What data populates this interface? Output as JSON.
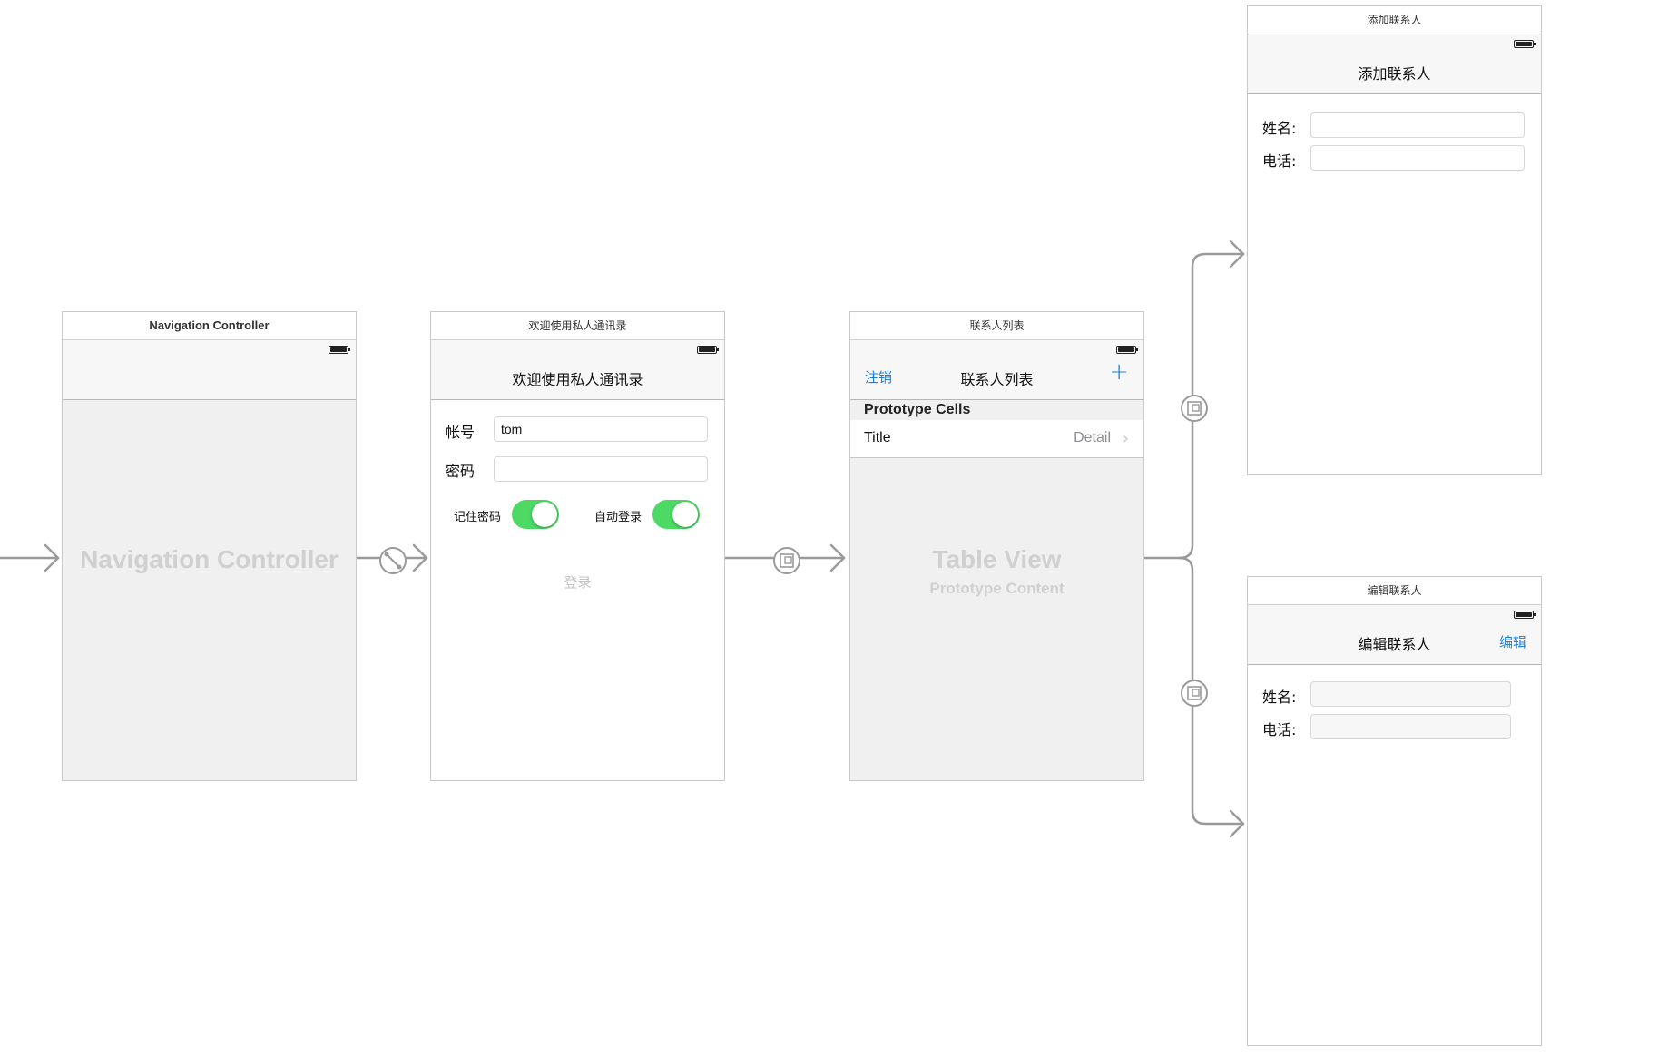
{
  "scenes": {
    "nav": {
      "title": "Navigation Controller",
      "placeholder": "Navigation Controller"
    },
    "login": {
      "title": "欢迎使用私人通讯录",
      "nav_title": "欢迎使用私人通讯录",
      "account_label": "帐号",
      "account_value": "tom",
      "password_label": "密码",
      "password_value": "",
      "remember_label": "记住密码",
      "remember_on": true,
      "auto_login_label": "自动登录",
      "auto_login_on": true,
      "login_button": "登录"
    },
    "contacts": {
      "title": "联系人列表",
      "nav_title": "联系人列表",
      "left_button": "注销",
      "right_icon": "plus-icon",
      "section_header": "Prototype Cells",
      "cell_title": "Title",
      "cell_detail": "Detail",
      "placeholder": "Table View",
      "placeholder_sub": "Prototype Content"
    },
    "add": {
      "title": "添加联系人",
      "nav_title": "添加联系人",
      "name_label": "姓名:",
      "phone_label": "电话:"
    },
    "edit": {
      "title": "编辑联系人",
      "nav_title": "编辑联系人",
      "right_button": "编辑",
      "name_label": "姓名:",
      "phone_label": "电话:"
    }
  },
  "colors": {
    "accent": "#1a7ee0",
    "switch_on": "#4cd964",
    "connector": "#9a9a9a"
  }
}
